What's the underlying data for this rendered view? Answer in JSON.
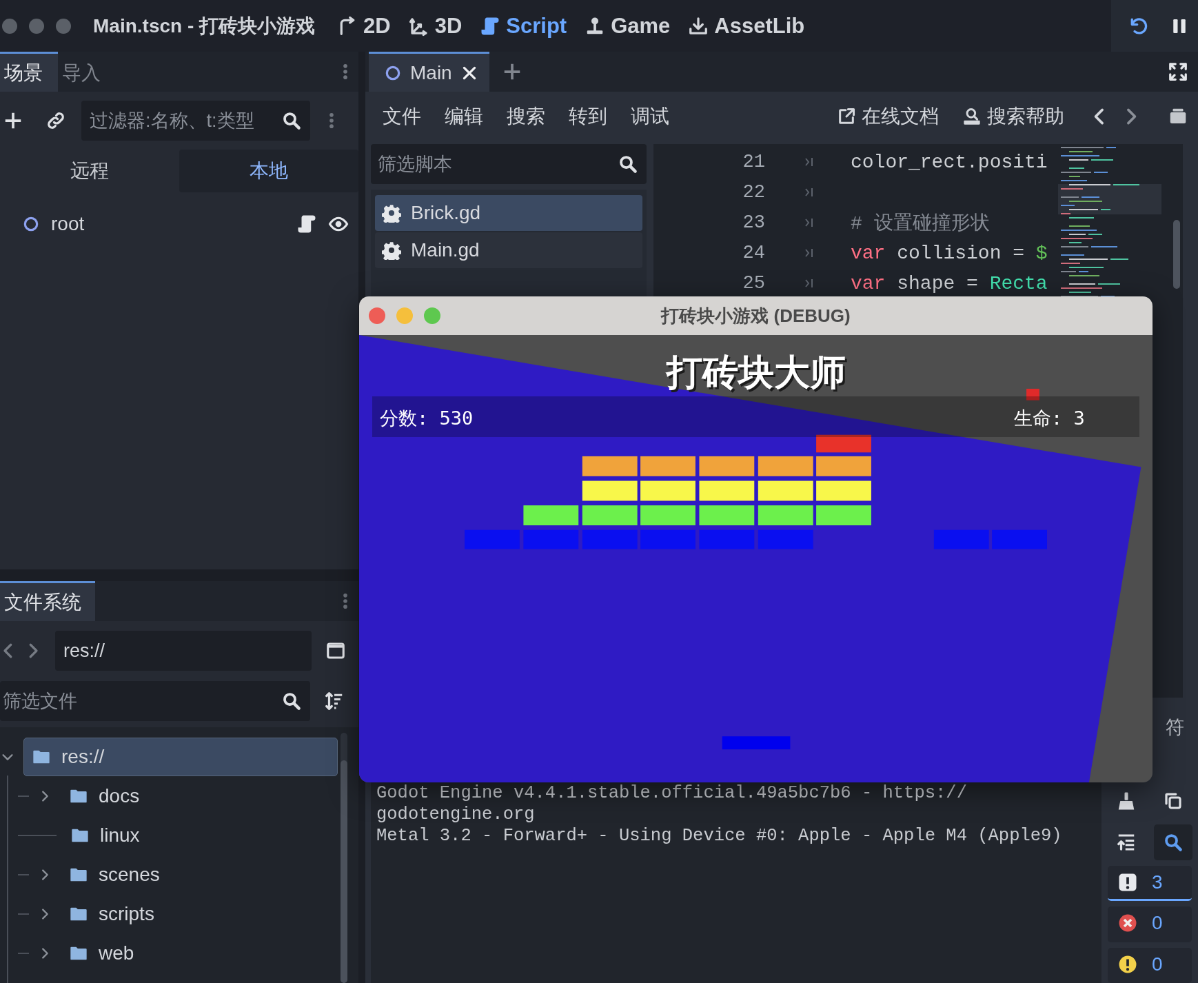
{
  "title_bar": {
    "window_controls": [
      {
        "kind": "close"
      },
      {
        "kind": "minimize"
      },
      {
        "kind": "zoom"
      }
    ],
    "title": "Main.tscn - 打砖块小游戏",
    "workspaces": [
      {
        "label": "2D",
        "selected": false
      },
      {
        "label": "3D",
        "selected": false
      },
      {
        "label": "Script",
        "selected": true
      },
      {
        "label": "Game",
        "selected": false
      },
      {
        "label": "AssetLib",
        "selected": false
      }
    ]
  },
  "scene_dock": {
    "tabs": [
      {
        "label": "场景",
        "selected": true
      },
      {
        "label": "导入",
        "selected": false
      }
    ],
    "filter": {
      "placeholder": "过滤器:名称、t:类型"
    },
    "modes": [
      {
        "label": "远程",
        "selected": false
      },
      {
        "label": "本地",
        "selected": true
      }
    ],
    "tree": [
      {
        "label": "root"
      }
    ]
  },
  "filesystem_dock": {
    "tab": "文件系统",
    "path": "res://",
    "filter": {
      "placeholder": "筛选文件"
    },
    "tree": [
      {
        "label": "res://",
        "selected": true,
        "expanded": true,
        "children": [
          {
            "label": "docs",
            "kind": "branch",
            "selected": false
          },
          {
            "label": "linux",
            "kind": "leaf",
            "selected": false
          },
          {
            "label": "scenes",
            "kind": "branch",
            "selected": false
          },
          {
            "label": "scripts",
            "kind": "branch",
            "selected": false
          },
          {
            "label": "web",
            "kind": "branch",
            "selected": false
          }
        ]
      }
    ]
  },
  "editor": {
    "tabs": [
      {
        "label": "Main",
        "selected": true
      }
    ],
    "menu": [
      "文件",
      "编辑",
      "搜索",
      "转到",
      "调试"
    ],
    "help_links": [
      "在线文档",
      "搜索帮助"
    ],
    "script_filter": {
      "placeholder": "筛选脚本"
    },
    "scripts": [
      {
        "label": "Brick.gd",
        "selected": true
      },
      {
        "label": "Main.gd",
        "selected": false
      }
    ],
    "code_lines": [
      {
        "number": "21",
        "tokens": [
          {
            "kind": "plain",
            "text": "color_rect.positi"
          }
        ]
      },
      {
        "number": "22"
      },
      {
        "number": "23",
        "tokens": [
          {
            "kind": "comment",
            "text": "# 设置碰撞形状"
          }
        ]
      },
      {
        "number": "24",
        "tokens": [
          {
            "kind": "keyword",
            "text": "var"
          },
          {
            "kind": "plain",
            "text": " collision = "
          },
          {
            "kind": "node",
            "text": "$"
          }
        ]
      },
      {
        "number": "25",
        "tokens": [
          {
            "kind": "keyword",
            "text": "var"
          },
          {
            "kind": "plain",
            "text": " shape = "
          },
          {
            "kind": "type",
            "text": "Recta"
          }
        ]
      }
    ],
    "status_text": "符"
  },
  "game_window": {
    "title": "打砖块小游戏 (DEBUG)",
    "game_title": "打砖块大师",
    "score": "分数: 530",
    "lives": "生命: 3"
  },
  "output": {
    "lines": [
      "Godot Engine v4.4.1.stable.official.49a5bc7b6 - https://",
      "godotengine.org",
      "Metal 3.2 - Forward+ - Using Device #0: Apple - Apple M4 (Apple9)"
    ],
    "filters": [
      {
        "kind": "message",
        "count": "3",
        "selected": true
      },
      {
        "kind": "error",
        "count": "0",
        "selected": false
      },
      {
        "kind": "warning",
        "count": "0",
        "selected": false
      }
    ]
  }
}
